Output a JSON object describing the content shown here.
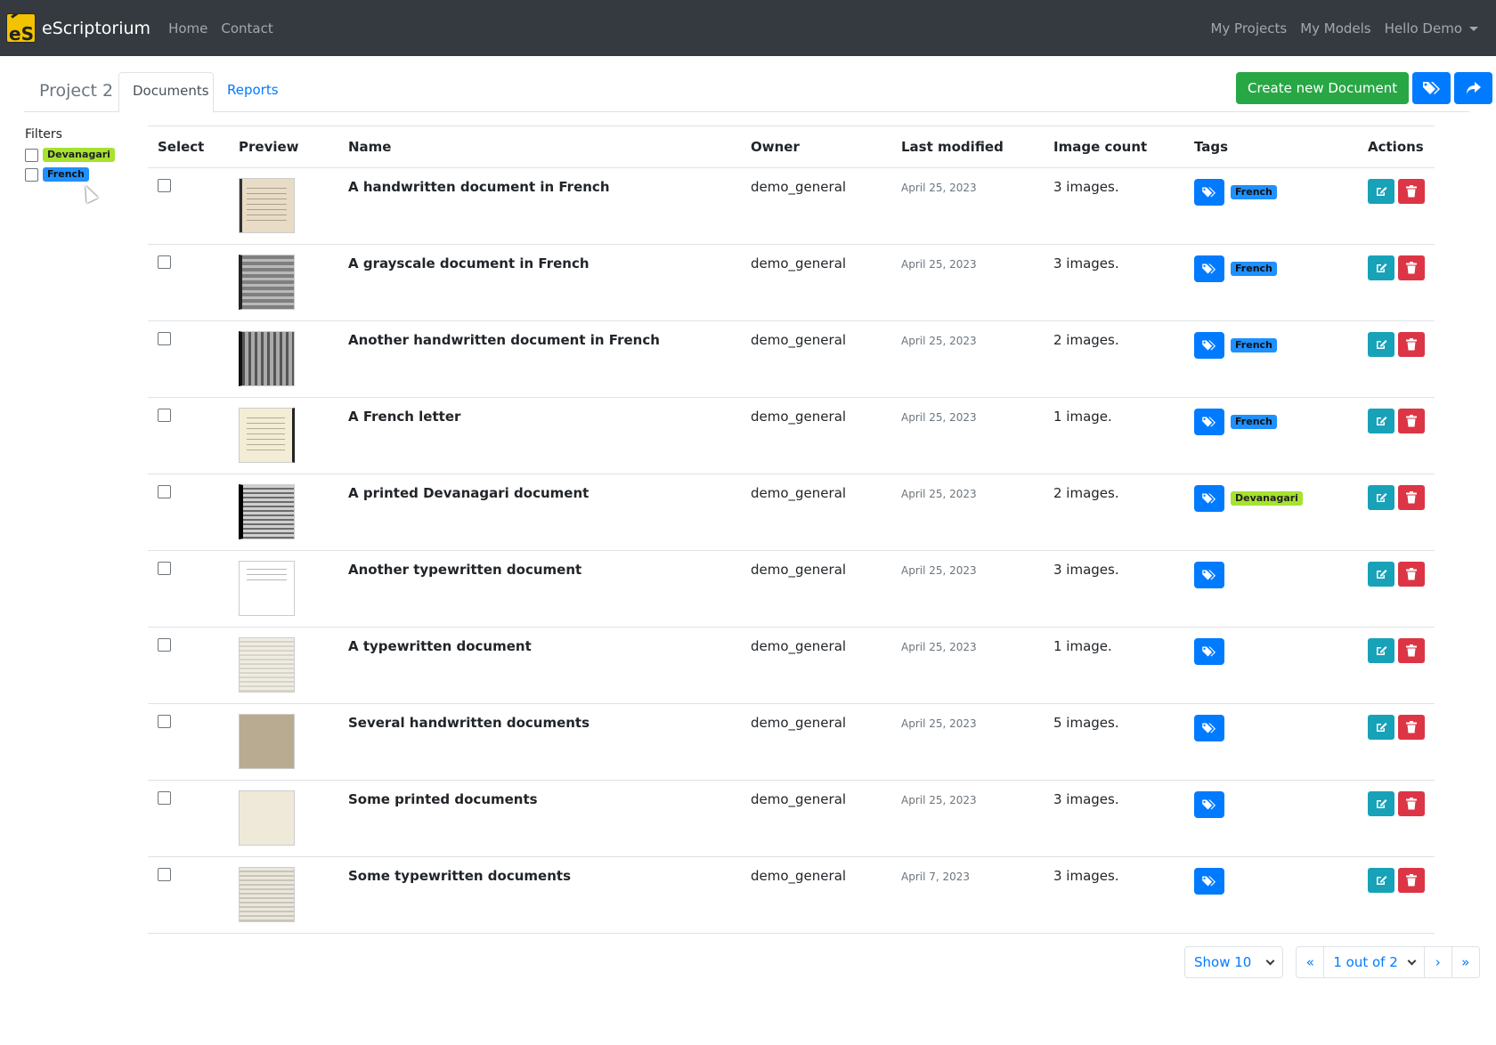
{
  "navbar": {
    "brand": "eScriptorium",
    "logo_text": "eS",
    "links": [
      "Home",
      "Contact"
    ],
    "right_links": [
      "My Projects",
      "My Models"
    ],
    "user_menu": "Hello Demo"
  },
  "project": {
    "title": "Project 2",
    "tabs": [
      "Documents",
      "Reports"
    ],
    "create_button": "Create new Document"
  },
  "filters": {
    "title": "Filters",
    "items": [
      {
        "label": "Devanagari",
        "color": "#a6e22e"
      },
      {
        "label": "French",
        "color": "#1e90ff"
      }
    ]
  },
  "table": {
    "headers": [
      "Select",
      "Preview",
      "Name",
      "Owner",
      "Last modified",
      "Image count",
      "Tags",
      "Actions"
    ],
    "rows": [
      {
        "name": "A handwritten document in French",
        "owner": "demo_general",
        "modified": "April 25, 2023",
        "images": "3 images.",
        "tag": "French"
      },
      {
        "name": "A grayscale document in French",
        "owner": "demo_general",
        "modified": "April 25, 2023",
        "images": "3 images.",
        "tag": "French"
      },
      {
        "name": "Another handwritten document in French",
        "owner": "demo_general",
        "modified": "April 25, 2023",
        "images": "2 images.",
        "tag": "French"
      },
      {
        "name": "A French letter",
        "owner": "demo_general",
        "modified": "April 25, 2023",
        "images": "1 image.",
        "tag": "French"
      },
      {
        "name": "A printed Devanagari document",
        "owner": "demo_general",
        "modified": "April 25, 2023",
        "images": "2 images.",
        "tag": "Devanagari"
      },
      {
        "name": "Another typewritten document",
        "owner": "demo_general",
        "modified": "April 25, 2023",
        "images": "3 images.",
        "tag": ""
      },
      {
        "name": "A typewritten document",
        "owner": "demo_general",
        "modified": "April 25, 2023",
        "images": "1 image.",
        "tag": ""
      },
      {
        "name": "Several handwritten documents",
        "owner": "demo_general",
        "modified": "April 25, 2023",
        "images": "5 images.",
        "tag": ""
      },
      {
        "name": "Some printed documents",
        "owner": "demo_general",
        "modified": "April 25, 2023",
        "images": "3 images.",
        "tag": ""
      },
      {
        "name": "Some typewritten documents",
        "owner": "demo_general",
        "modified": "April 7, 2023",
        "images": "3 images.",
        "tag": ""
      }
    ]
  },
  "pagination": {
    "page_size": "Show 10",
    "first": "«",
    "prev": "‹",
    "page_label": "1 out of 2",
    "next": "›",
    "last": "»"
  },
  "colors": {
    "navbar": "#343a40",
    "primary": "#007bff",
    "success": "#28a745",
    "info": "#17a2b8",
    "danger": "#dc3545"
  },
  "icons": [
    "tags-icon",
    "share-icon",
    "tag-icon",
    "edit-icon",
    "trash-icon",
    "chevron-down-icon",
    "caret-down-icon"
  ]
}
